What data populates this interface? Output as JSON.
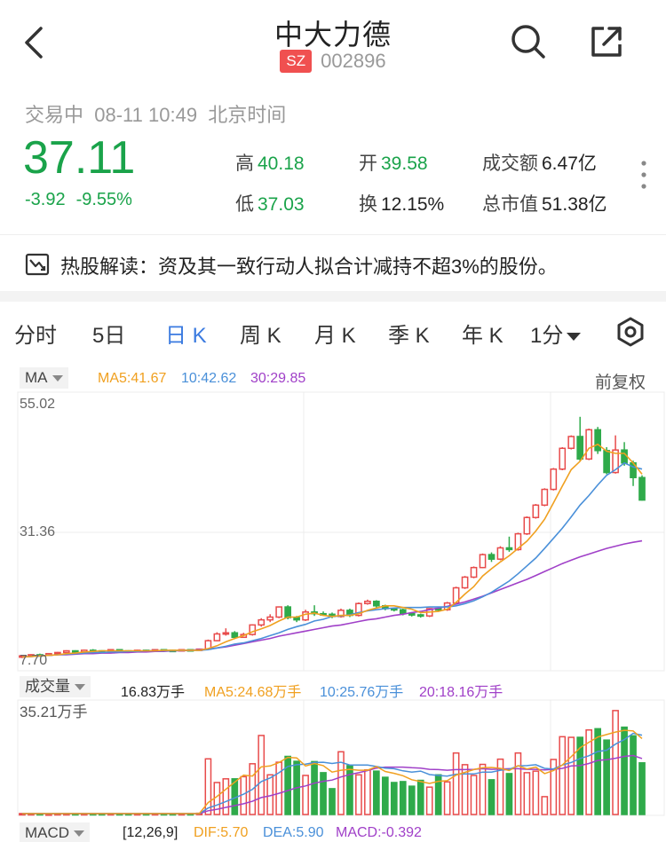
{
  "header": {
    "title": "中大力德",
    "market": "SZ",
    "code": "002896"
  },
  "status": {
    "state": "交易中",
    "datetime": "08-11 10:49",
    "timezone": "北京时间"
  },
  "quote": {
    "price": "37.11",
    "change": "-3.92",
    "change_pct": "-9.55%",
    "high_label": "高",
    "high": "40.18",
    "open_label": "开",
    "open": "39.58",
    "turnover_label": "成交额",
    "turnover": "6.47亿",
    "low_label": "低",
    "low": "37.03",
    "exchange_label": "换",
    "exchange": "12.15%",
    "mktcap_label": "总市值",
    "mktcap": "51.38亿"
  },
  "hot": {
    "text": "热股解读：资及其一致行动人拟合计减持不超3%的股份。"
  },
  "tabs": [
    "分时",
    "5日",
    "日 K",
    "周 K",
    "月 K",
    "季 K",
    "年 K",
    "1分"
  ],
  "active_tab": 2,
  "ma_legend": {
    "selector": "MA",
    "ma5": "MA5:41.67",
    "ma10": "10:42.62",
    "ma30": "30:29.85",
    "adjust": "前复权"
  },
  "vol_legend": {
    "selector": "成交量",
    "vol": "16.83万手",
    "ma5": "MA5:24.68万手",
    "ma10": "10:25.76万手",
    "ma20": "20:18.16万手",
    "max": "35.21万手"
  },
  "macd_legend": {
    "selector": "MACD",
    "params": "[12,26,9]",
    "dif": "DIF:5.70",
    "dea": "DEA:5.90",
    "macd": "MACD:-0.392"
  },
  "colors": {
    "up": "#e84b4b",
    "down": "#2faa4a",
    "ma5": "#f0a020",
    "ma10": "#4a90d9",
    "ma30": "#a040c8",
    "active": "#3b7be0"
  },
  "chart_data": {
    "type": "candlestick",
    "y_ticks": [
      "55.02",
      "31.36",
      "7.70"
    ],
    "ylim": [
      7.7,
      55.02
    ],
    "candles": [
      [
        9.2,
        9.4,
        9.0,
        9.5
      ],
      [
        9.4,
        9.6,
        9.3,
        9.7
      ],
      [
        9.6,
        9.5,
        9.4,
        9.8
      ],
      [
        9.5,
        9.8,
        9.4,
        9.9
      ],
      [
        9.8,
        10.0,
        9.7,
        10.1
      ],
      [
        10.0,
        10.3,
        9.9,
        10.4
      ],
      [
        10.3,
        10.1,
        10.0,
        10.4
      ],
      [
        10.1,
        10.4,
        10.0,
        10.5
      ],
      [
        10.4,
        10.3,
        10.2,
        10.6
      ],
      [
        10.3,
        10.2,
        10.1,
        10.4
      ],
      [
        10.2,
        10.5,
        10.1,
        10.6
      ],
      [
        10.5,
        10.3,
        10.2,
        10.6
      ],
      [
        10.3,
        10.2,
        10.1,
        10.4
      ],
      [
        10.2,
        10.4,
        10.1,
        10.5
      ],
      [
        10.4,
        10.3,
        10.2,
        10.5
      ],
      [
        10.3,
        10.5,
        10.2,
        10.6
      ],
      [
        10.5,
        10.4,
        10.3,
        10.6
      ],
      [
        10.4,
        10.3,
        10.2,
        10.5
      ],
      [
        10.3,
        10.5,
        10.2,
        10.6
      ],
      [
        10.5,
        10.4,
        10.3,
        10.6
      ],
      [
        10.4,
        10.6,
        10.3,
        10.7
      ],
      [
        10.6,
        12.1,
        10.5,
        12.3
      ],
      [
        12.1,
        13.3,
        12.0,
        13.6
      ],
      [
        13.3,
        13.5,
        13.0,
        14.3
      ],
      [
        13.5,
        12.7,
        12.4,
        13.8
      ],
      [
        12.7,
        13.2,
        12.6,
        13.5
      ],
      [
        13.2,
        14.9,
        13.0,
        15.0
      ],
      [
        14.9,
        15.8,
        14.6,
        16.1
      ],
      [
        15.8,
        16.3,
        15.4,
        16.8
      ],
      [
        16.3,
        18.1,
        16.1,
        18.2
      ],
      [
        18.1,
        16.2,
        15.9,
        18.4
      ],
      [
        16.2,
        15.8,
        15.4,
        16.5
      ],
      [
        15.8,
        17.2,
        15.6,
        17.6
      ],
      [
        17.2,
        16.9,
        16.5,
        18.4
      ],
      [
        16.9,
        16.8,
        16.5,
        17.3
      ],
      [
        16.8,
        16.4,
        16.1,
        17.1
      ],
      [
        16.4,
        17.5,
        16.2,
        17.8
      ],
      [
        17.5,
        16.6,
        16.3,
        17.8
      ],
      [
        16.6,
        18.7,
        16.4,
        18.9
      ],
      [
        18.7,
        19.1,
        18.5,
        19.4
      ],
      [
        19.1,
        18.3,
        17.9,
        19.3
      ],
      [
        18.3,
        17.8,
        17.5,
        18.5
      ],
      [
        17.8,
        17.6,
        17.3,
        18.0
      ],
      [
        17.6,
        16.9,
        16.6,
        17.8
      ],
      [
        16.9,
        16.7,
        16.4,
        17.1
      ],
      [
        16.7,
        16.5,
        16.2,
        16.9
      ],
      [
        16.5,
        17.8,
        16.3,
        17.9
      ],
      [
        17.8,
        17.6,
        17.3,
        18.0
      ],
      [
        17.6,
        18.8,
        17.4,
        19.0
      ],
      [
        18.8,
        21.5,
        18.6,
        21.7
      ],
      [
        21.5,
        23.4,
        21.3,
        23.6
      ],
      [
        23.4,
        25.1,
        23.2,
        25.3
      ],
      [
        25.1,
        27.4,
        25.0,
        27.6
      ],
      [
        27.4,
        26.6,
        26.1,
        27.8
      ],
      [
        26.6,
        28.6,
        26.4,
        28.9
      ],
      [
        28.6,
        28.3,
        27.9,
        30.6
      ],
      [
        28.3,
        31.1,
        28.1,
        31.3
      ],
      [
        31.1,
        34.0,
        30.9,
        34.2
      ],
      [
        34.0,
        36.2,
        33.8,
        36.4
      ],
      [
        36.2,
        39.0,
        36.0,
        39.2
      ],
      [
        39.0,
        42.6,
        38.8,
        42.8
      ],
      [
        42.6,
        46.3,
        42.4,
        46.5
      ],
      [
        46.3,
        48.4,
        46.1,
        48.6
      ],
      [
        48.4,
        44.4,
        44.0,
        51.9
      ],
      [
        44.4,
        49.6,
        44.2,
        49.8
      ],
      [
        49.6,
        45.9,
        45.3,
        50.1
      ],
      [
        45.9,
        42.0,
        41.7,
        46.5
      ],
      [
        42.0,
        46.0,
        41.8,
        48.6
      ],
      [
        46.0,
        43.7,
        43.2,
        47.4
      ],
      [
        43.7,
        41.1,
        39.6,
        44.1
      ],
      [
        41.1,
        37.1,
        37.0,
        41.5
      ]
    ],
    "ma5": [
      9.2,
      9.3,
      9.4,
      9.5,
      9.6,
      9.8,
      9.9,
      10.1,
      10.2,
      10.3,
      10.3,
      10.3,
      10.3,
      10.3,
      10.3,
      10.3,
      10.4,
      10.4,
      10.4,
      10.4,
      10.4,
      10.7,
      11.2,
      11.9,
      12.5,
      13.0,
      13.7,
      14.2,
      14.8,
      15.6,
      16.3,
      16.3,
      16.8,
      17.0,
      16.6,
      16.4,
      16.6,
      16.6,
      16.9,
      17.5,
      17.9,
      18.3,
      18.3,
      18.0,
      17.7,
      17.1,
      17.2,
      17.3,
      17.7,
      18.9,
      20.4,
      21.7,
      23.6,
      24.9,
      26.1,
      27.2,
      28.5,
      29.8,
      31.6,
      33.7,
      36.6,
      39.6,
      42.5,
      44.0,
      46.3,
      47.0,
      45.8,
      45.4,
      45.4,
      43.7,
      41.7
    ],
    "ma10": [
      9.2,
      9.3,
      9.4,
      9.5,
      9.6,
      9.7,
      9.8,
      9.9,
      10.0,
      10.0,
      10.1,
      10.1,
      10.2,
      10.2,
      10.3,
      10.3,
      10.3,
      10.3,
      10.4,
      10.4,
      10.4,
      10.5,
      10.8,
      11.1,
      11.5,
      11.7,
      12.1,
      12.5,
      13.0,
      13.5,
      14.1,
      14.6,
      15.0,
      15.6,
      15.9,
      16.4,
      16.5,
      16.7,
      17.1,
      17.4,
      17.6,
      17.8,
      17.9,
      18.0,
      18.0,
      18.0,
      18.1,
      18.1,
      18.1,
      18.3,
      18.7,
      19.2,
      19.9,
      20.7,
      21.7,
      22.7,
      24.0,
      25.4,
      26.8,
      28.5,
      30.3,
      32.1,
      34.1,
      36.2,
      37.9,
      39.8,
      41.5,
      42.5,
      43.7,
      43.0,
      42.6
    ],
    "ma30": [
      9.2,
      9.3,
      9.4,
      9.5,
      9.6,
      9.6,
      9.7,
      9.8,
      9.8,
      9.9,
      9.9,
      10.0,
      10.0,
      10.1,
      10.1,
      10.2,
      10.2,
      10.3,
      10.3,
      10.4,
      10.5,
      10.6,
      10.8,
      11.0,
      11.3,
      11.6,
      11.9,
      12.2,
      12.5,
      12.9,
      13.2,
      13.5,
      13.8,
      14.1,
      14.4,
      14.7,
      14.9,
      15.2,
      15.5,
      15.8,
      16.0,
      16.3,
      16.6,
      16.8,
      17.1,
      17.3,
      17.6,
      17.9,
      18.2,
      18.6,
      19.0,
      19.5,
      20.0,
      20.6,
      21.2,
      21.8,
      22.4,
      23.0,
      23.7,
      24.4,
      25.1,
      25.8,
      26.4,
      27.0,
      27.5,
      28.0,
      28.5,
      28.9,
      29.3,
      29.6,
      29.85
    ]
  },
  "volume_data": {
    "vol": [
      0.3,
      0.3,
      0.3,
      0.2,
      0.3,
      0.3,
      0.3,
      0.3,
      0.3,
      0.3,
      0.3,
      0.3,
      0.3,
      0.3,
      0.3,
      0.3,
      0.3,
      0.3,
      0.3,
      0.3,
      0.4,
      18.1,
      10.4,
      11.6,
      11.6,
      12.3,
      16.5,
      25.7,
      12.9,
      17.0,
      18.9,
      17.3,
      12.7,
      17.2,
      13.6,
      8.4,
      20.4,
      15.9,
      12.9,
      14.5,
      14.1,
      12.1,
      10.4,
      10.7,
      9.2,
      11.1,
      8.9,
      12.9,
      10.6,
      20.0,
      16.2,
      12.7,
      16.3,
      11.3,
      18.0,
      13.3,
      20.0,
      13.6,
      14.1,
      5.8,
      17.9,
      25.3,
      25.1,
      25.1,
      27.5,
      27.9,
      24.2,
      33.8,
      28.4,
      25.6,
      16.8
    ],
    "ma5": [
      0.3,
      0.3,
      0.3,
      0.3,
      0.3,
      0.3,
      0.3,
      0.3,
      0.3,
      0.3,
      0.3,
      0.3,
      0.3,
      0.3,
      0.3,
      0.3,
      0.3,
      0.3,
      0.3,
      0.3,
      0.3,
      3.9,
      5.9,
      8.2,
      10.5,
      12.8,
      12.5,
      15.5,
      15.8,
      16.9,
      18.6,
      18.4,
      15.8,
      16.6,
      15.9,
      13.8,
      14.4,
      14.7,
      14.4,
      14.4,
      15.6,
      14.0,
      13.4,
      12.6,
      11.3,
      10.7,
      10.1,
      10.8,
      11.0,
      12.8,
      13.7,
      14.6,
      15.2,
      15.3,
      15.0,
      14.3,
      15.9,
      14.8,
      15.4,
      13.3,
      14.3,
      16.1,
      18.8,
      21.7,
      23.5,
      25.2,
      26.0,
      26.8,
      27.4,
      27.2,
      24.7
    ],
    "ma10": [
      0.3,
      0.3,
      0.3,
      0.3,
      0.3,
      0.3,
      0.3,
      0.3,
      0.3,
      0.3,
      0.3,
      0.3,
      0.3,
      0.3,
      0.3,
      0.3,
      0.3,
      0.3,
      0.3,
      0.3,
      0.3,
      2.1,
      3.1,
      4.2,
      5.4,
      6.6,
      8.2,
      10.7,
      11.9,
      13.6,
      15.6,
      16.2,
      16.4,
      16.9,
      17.0,
      16.6,
      17.0,
      16.1,
      16.1,
      16.1,
      15.6,
      15.1,
      14.9,
      14.2,
      13.8,
      14.1,
      13.0,
      12.7,
      12.5,
      13.1,
      13.2,
      13.2,
      13.8,
      13.8,
      14.4,
      14.7,
      15.8,
      15.9,
      16.2,
      15.0,
      14.8,
      16.1,
      16.9,
      18.2,
      19.1,
      20.5,
      20.9,
      22.9,
      24.4,
      26.4,
      25.8
    ],
    "ma20": [
      0.3,
      0.3,
      0.3,
      0.3,
      0.3,
      0.3,
      0.3,
      0.3,
      0.3,
      0.3,
      0.3,
      0.3,
      0.3,
      0.3,
      0.3,
      0.3,
      0.3,
      0.3,
      0.3,
      0.3,
      0.3,
      1.2,
      1.7,
      2.3,
      2.9,
      3.5,
      4.3,
      5.5,
      6.1,
      6.9,
      7.8,
      8.7,
      9.3,
      10.2,
      10.8,
      11.2,
      12.2,
      13.0,
      13.6,
      14.3,
      15.1,
      15.4,
      15.4,
      15.4,
      15.2,
      15.1,
      14.7,
      14.6,
      14.4,
      14.6,
      14.6,
      14.7,
      14.9,
      14.7,
      14.8,
      14.9,
      14.9,
      14.7,
      14.7,
      14.5,
      14.7,
      15.0,
      15.8,
      15.9,
      16.6,
      17.6,
      17.8,
      18.3,
      18.9,
      19.2,
      18.2
    ],
    "ylim": [
      0,
      35.21
    ]
  }
}
